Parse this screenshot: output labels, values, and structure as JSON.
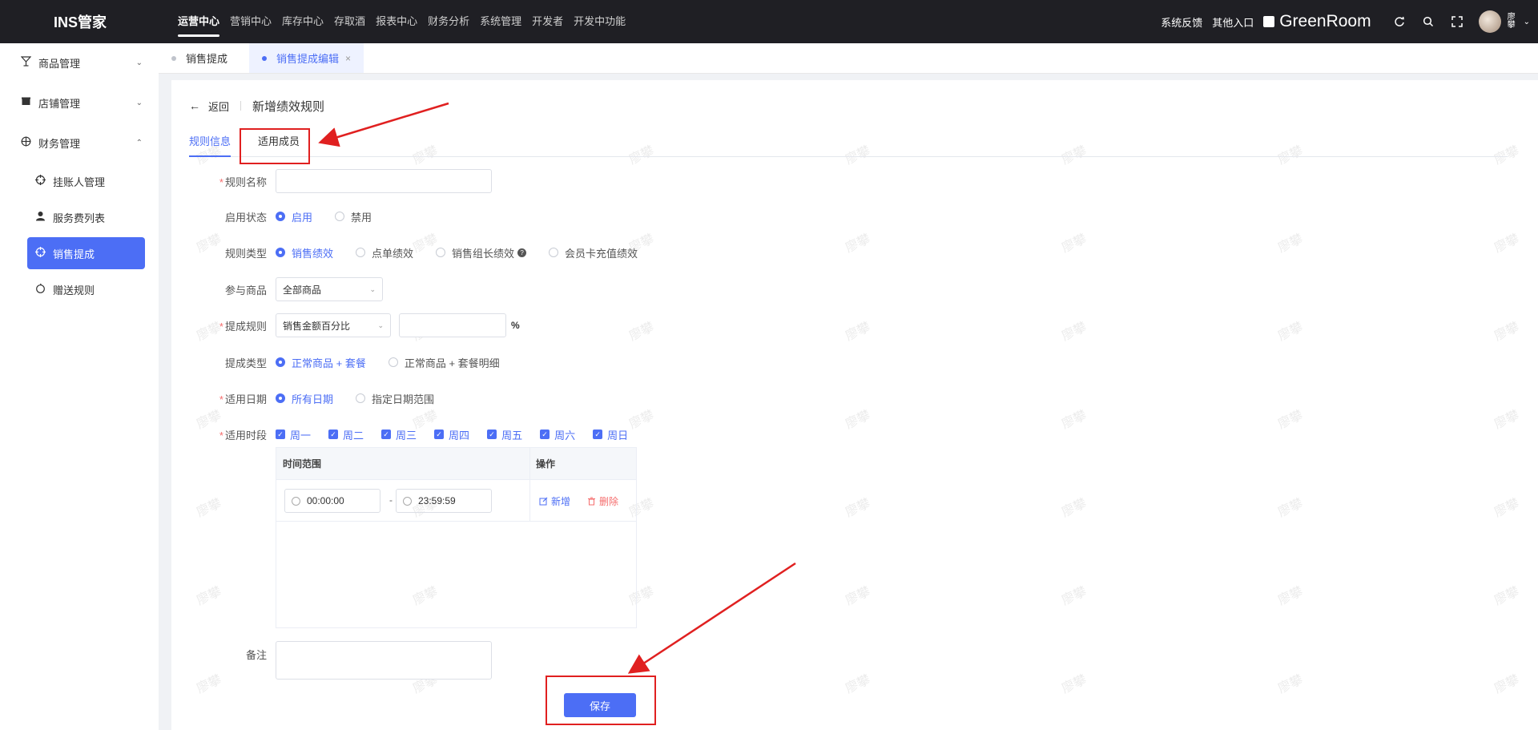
{
  "app": {
    "brand": "INS管家"
  },
  "topnav": {
    "items": [
      "运营中心",
      "营销中心",
      "库存中心",
      "存取酒",
      "报表中心",
      "财务分析",
      "系统管理",
      "开发者",
      "开发中功能"
    ],
    "active_index": 0
  },
  "topright": {
    "feedback": "系统反馈",
    "other_entry": "其他入口",
    "store_name": "GreenRoom",
    "user_name": "廖攀"
  },
  "sidebar": {
    "groups": [
      {
        "label": "商品管理",
        "icon": "cocktail-icon",
        "expanded": false
      },
      {
        "label": "店铺管理",
        "icon": "shop-icon",
        "expanded": false
      },
      {
        "label": "财务管理",
        "icon": "finance-icon",
        "expanded": true
      }
    ],
    "finance_children": [
      {
        "label": "挂账人管理",
        "icon": "target-icon"
      },
      {
        "label": "服务费列表",
        "icon": "person-icon"
      },
      {
        "label": "销售提成",
        "icon": "target-icon",
        "active": true
      },
      {
        "label": "赠送规则",
        "icon": "apple-icon"
      }
    ]
  },
  "page_tabs": [
    {
      "label": "销售提成",
      "active": false
    },
    {
      "label": "销售提成编辑",
      "active": true,
      "close": "×"
    }
  ],
  "header": {
    "back_label": "返回",
    "title": "新增绩效规则"
  },
  "form_tabs": {
    "rule_info": "规则信息",
    "members": "适用成员"
  },
  "watermark": "廖攀",
  "form": {
    "rule_name": {
      "label": "规则名称",
      "value": ""
    },
    "status": {
      "label": "启用状态",
      "options": [
        "启用",
        "禁用"
      ],
      "selected": 0
    },
    "rule_type": {
      "label": "规则类型",
      "options": [
        "销售绩效",
        "点单绩效",
        "销售组长绩效",
        "会员卡充值绩效"
      ],
      "selected": 0,
      "help": "?"
    },
    "goods": {
      "label": "参与商品",
      "value": "全部商品"
    },
    "commission_rule": {
      "label": "提成规则",
      "mode": "销售金额百分比",
      "value": "",
      "unit": "%"
    },
    "commission_type": {
      "label": "提成类型",
      "options": [
        "正常商品 + 套餐",
        "正常商品 + 套餐明细"
      ],
      "selected": 0
    },
    "date_range": {
      "label": "适用日期",
      "options": [
        "所有日期",
        "指定日期范围"
      ],
      "selected": 0
    },
    "time_slot": {
      "label": "适用时段",
      "days": [
        "周一",
        "周二",
        "周三",
        "周四",
        "周五",
        "周六",
        "周日"
      ]
    },
    "time_table": {
      "headers": [
        "时间范围",
        "操作"
      ],
      "rows": [
        {
          "start": "00:00:00",
          "sep": "-",
          "end": "23:59:59",
          "add": "新增",
          "delete": "删除"
        }
      ]
    },
    "remark": {
      "label": "备注",
      "value": ""
    },
    "save": "保存"
  }
}
